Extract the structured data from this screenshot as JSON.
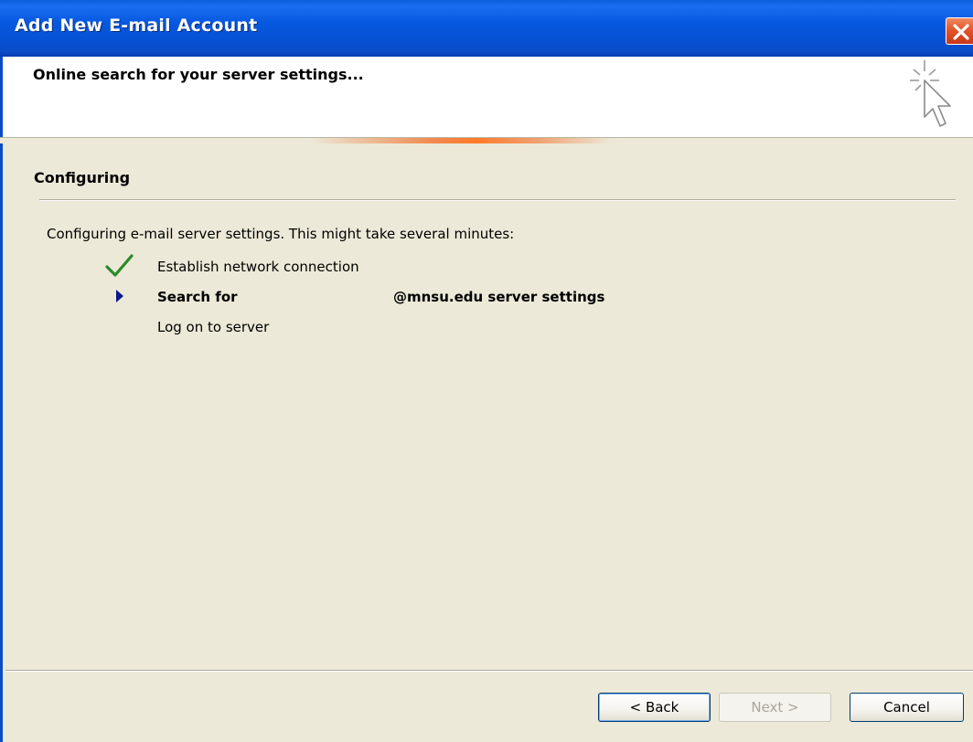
{
  "window": {
    "title": "Add New E-mail Account",
    "close_icon": "close-icon"
  },
  "header": {
    "title": "Online search for your server settings...",
    "icon": "wizard-cursor-icon"
  },
  "section": {
    "title": "Configuring",
    "intro": "Configuring e-mail server settings. This might take several minutes:"
  },
  "steps": [
    {
      "label": "Establish network connection",
      "status": "done",
      "icon": "checkmark-icon"
    },
    {
      "label": "Search for",
      "label_suffix": "@mnsu.edu server settings",
      "status": "in-progress",
      "icon": "arrow-right-icon"
    },
    {
      "label": "Log on to server",
      "status": "pending",
      "icon": ""
    }
  ],
  "buttons": {
    "back": "< Back",
    "next": "Next >",
    "cancel": "Cancel"
  },
  "colors": {
    "titlebar": "#0558D8",
    "dialog_bg": "#ECE9D8",
    "check": "#2a8a2a",
    "arrow": "#0a1a8a"
  }
}
